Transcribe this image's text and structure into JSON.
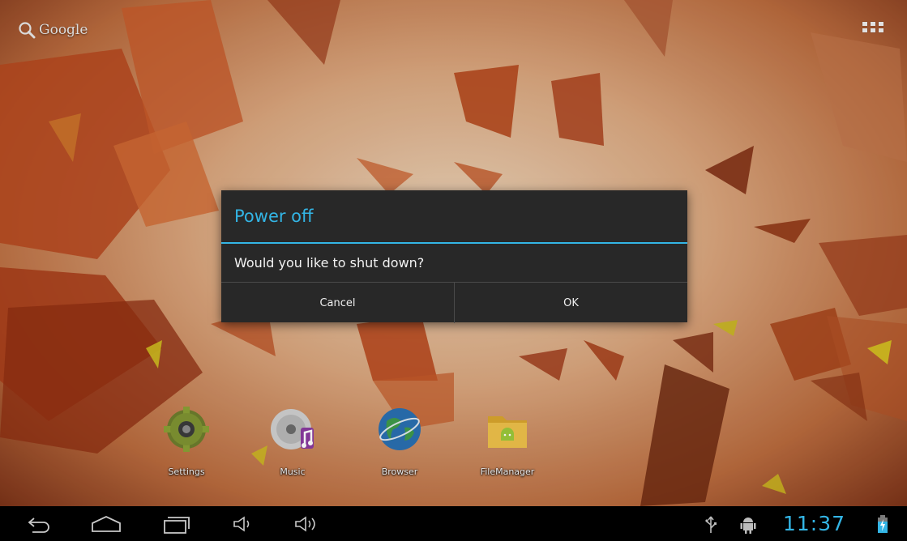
{
  "home": {
    "search_label": "Google",
    "dock": [
      {
        "label": "Settings",
        "icon": "settings-gear-icon"
      },
      {
        "label": "Music",
        "icon": "music-disc-icon"
      },
      {
        "label": "Browser",
        "icon": "browser-globe-icon"
      },
      {
        "label": "FileManager",
        "icon": "file-manager-folder-icon"
      }
    ]
  },
  "dialog": {
    "title": "Power off",
    "message": "Would you like to shut down?",
    "cancel_label": "Cancel",
    "ok_label": "OK"
  },
  "status_bar": {
    "time": "11:37"
  },
  "colors": {
    "accent": "#33b5e5",
    "dialog_bg": "#282828"
  }
}
